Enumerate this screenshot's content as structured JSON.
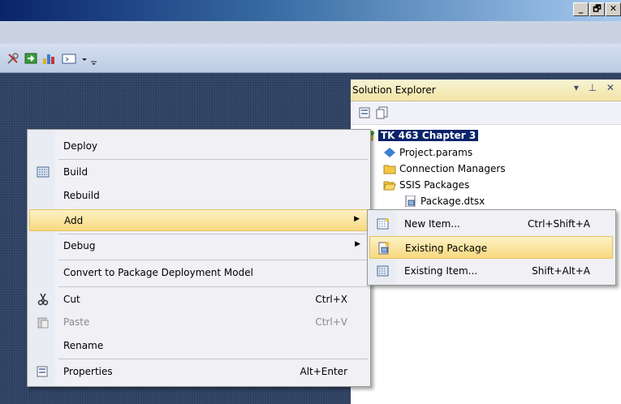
{
  "window": {
    "controls": [
      "_",
      "🗗",
      "✕"
    ]
  },
  "toolbar": {
    "icons": [
      "tools-icon",
      "deploy-icon",
      "chart-icon",
      "window-icon",
      "dropdown-icon",
      "overflow-icon"
    ]
  },
  "solution_explorer": {
    "title": "Solution Explorer",
    "controls": "▾ ⊥ ✕",
    "tree": {
      "project": "TK 463 Chapter 3",
      "items": [
        "Project.params",
        "Connection Managers",
        "SSIS Packages"
      ],
      "package": "Package.dtsx"
    }
  },
  "context_menu": {
    "items": [
      {
        "label": "Deploy"
      },
      {
        "label": "Build"
      },
      {
        "label": "Rebuild"
      },
      {
        "label": "Add",
        "arrow": "▶"
      },
      {
        "label": "Debug",
        "arrow": "▶"
      },
      {
        "label": "Convert to Package Deployment Model"
      },
      {
        "label": "Cut",
        "shortcut": "Ctrl+X"
      },
      {
        "label": "Paste",
        "shortcut": "Ctrl+V"
      },
      {
        "label": "Rename"
      },
      {
        "label": "Properties",
        "shortcut": "Alt+Enter"
      }
    ]
  },
  "submenu": {
    "items": [
      {
        "label": "New Item...",
        "shortcut": "Ctrl+Shift+A"
      },
      {
        "label": "Existing Package",
        "shortcut": ""
      },
      {
        "label": "Existing Item...",
        "shortcut": "Shift+Alt+A"
      }
    ]
  },
  "colors": {
    "highlight": "#f7d97e",
    "selection": "#0a246a",
    "workspace": "#2d3f5f"
  }
}
